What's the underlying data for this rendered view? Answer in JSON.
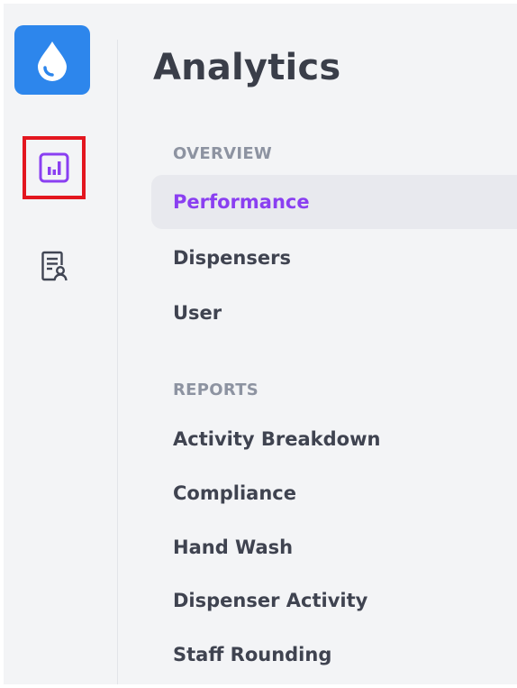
{
  "app": {
    "brand_color": "#2d86ec",
    "accent_color": "#8a3ff1",
    "highlight_color": "#e3161f"
  },
  "rail": {
    "logo_icon": "water-drop-icon",
    "items": [
      {
        "icon": "bar-chart-icon",
        "label": "Analytics",
        "selected": true
      },
      {
        "icon": "document-user-icon",
        "label": "Reports",
        "selected": false
      }
    ]
  },
  "panel": {
    "title": "Analytics",
    "sections": [
      {
        "heading": "OVERVIEW",
        "items": [
          {
            "label": "Performance",
            "active": true
          },
          {
            "label": "Dispensers",
            "active": false
          },
          {
            "label": "User",
            "active": false
          }
        ]
      },
      {
        "heading": "REPORTS",
        "items": [
          {
            "label": "Activity Breakdown",
            "active": false
          },
          {
            "label": "Compliance",
            "active": false
          },
          {
            "label": "Hand Wash",
            "active": false
          },
          {
            "label": "Dispenser Activity",
            "active": false
          },
          {
            "label": "Staff Rounding",
            "active": false
          }
        ]
      }
    ]
  }
}
